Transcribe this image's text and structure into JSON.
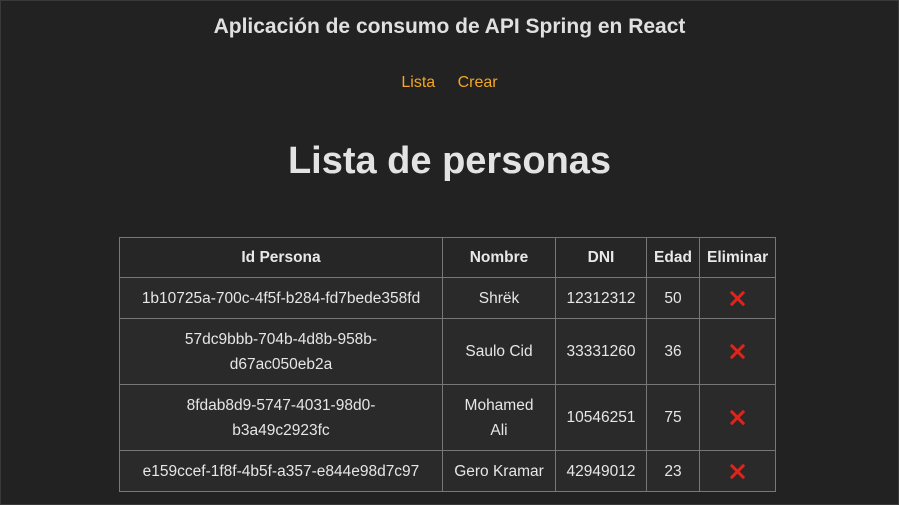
{
  "app": {
    "title": "Aplicación de consumo de API Spring en React"
  },
  "nav": {
    "items": [
      {
        "label": "Lista"
      },
      {
        "label": "Crear"
      }
    ]
  },
  "page": {
    "heading": "Lista de personas"
  },
  "table": {
    "columns": [
      "Id Persona",
      "Nombre",
      "DNI",
      "Edad",
      "Eliminar"
    ],
    "rows": [
      {
        "id": "1b10725a-700c-4f5f-b284-fd7bede358fd",
        "nombre": "Shrëk",
        "dni": "12312312",
        "edad": "50",
        "eliminar_icon": "close-icon"
      },
      {
        "id": "57dc9bbb-704b-4d8b-958b-d67ac050eb2a",
        "nombre": "Saulo Cid",
        "dni": "33331260",
        "edad": "36",
        "eliminar_icon": "close-icon"
      },
      {
        "id": "8fdab8d9-5747-4031-98d0-b3a49c2923fc",
        "nombre": "Mohamed Ali",
        "dni": "10546251",
        "edad": "75",
        "eliminar_icon": "close-icon"
      },
      {
        "id": "e159ccef-1f8f-4b5f-a357-e844e98d7c97",
        "nombre": "Gero Kramar",
        "dni": "42949012",
        "edad": "23",
        "eliminar_icon": "close-icon"
      }
    ]
  },
  "colors": {
    "background": "#222222",
    "link": "#f5a623",
    "delete": "#e0241b"
  }
}
